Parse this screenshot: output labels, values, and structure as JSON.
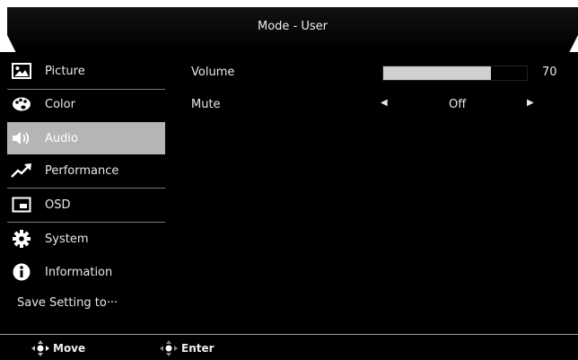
{
  "header": {
    "title": "Mode - User"
  },
  "sidebar": {
    "items": [
      {
        "label": "Picture",
        "icon": "picture-icon",
        "active": false
      },
      {
        "label": "Color",
        "icon": "color-palette-icon",
        "active": false
      },
      {
        "label": "Audio",
        "icon": "speaker-icon",
        "active": true
      },
      {
        "label": "Performance",
        "icon": "trend-arrow-icon",
        "active": false
      },
      {
        "label": "OSD",
        "icon": "osd-window-icon",
        "active": false
      },
      {
        "label": "System",
        "icon": "gear-icon",
        "active": false
      },
      {
        "label": "Information",
        "icon": "info-icon",
        "active": false
      }
    ],
    "save_label": "Save Setting to···"
  },
  "settings": {
    "volume": {
      "label": "Volume",
      "value": "70",
      "level_percent": 75
    },
    "mute": {
      "label": "Mute",
      "value": "Off"
    }
  },
  "footer": {
    "move_label": "Move",
    "enter_label": "Enter"
  },
  "colors": {
    "background": "#000000",
    "active_item": "#b5b5b5",
    "volume_fill": "#d0d0d0",
    "text": "#e8e8e8"
  }
}
